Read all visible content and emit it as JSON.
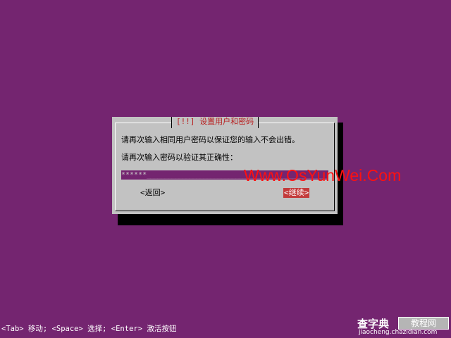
{
  "dialog": {
    "title": "[!!] 设置用户和密码",
    "line1": "请再次输入相同用户密码以保证您的输入不会出错。",
    "line2": "请再次输入密码以验证其正确性：",
    "password_field": {
      "value": "******",
      "filler": "_____________________________________________________________"
    },
    "back_button": "<返回>",
    "continue_button": "<继续>"
  },
  "watermark": "Www.OsYunWei.Com",
  "hint_bar": "<Tab> 移动; <Space> 选择; <Enter> 激活按钮",
  "logo": {
    "main": "查字典",
    "box": "教程网",
    "url": "jiaocheng.chazidian.com"
  },
  "colors": {
    "background": "#742570",
    "dialog_bg": "#c2c2c2",
    "title_red": "#b81f1f",
    "selected_button": "#c33b3b",
    "watermark_red": "#ff1010"
  }
}
